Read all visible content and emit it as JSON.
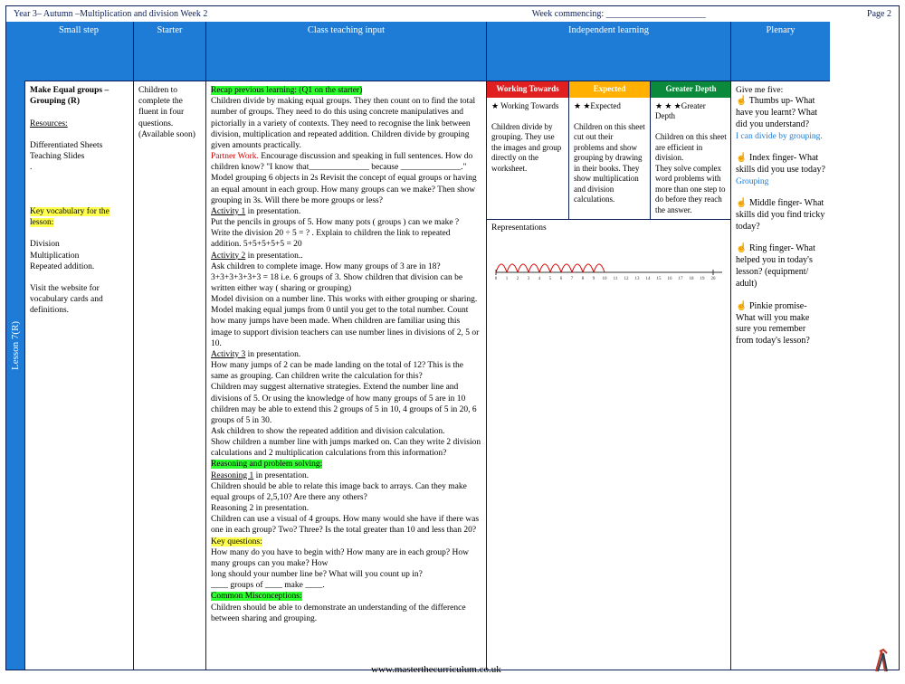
{
  "top": {
    "left": "Year 3– Autumn –Multiplication and division Week 2",
    "mid": "Week commencing: ______________________",
    "right": "Page 2"
  },
  "lesson_tab": "Lesson  7(R)",
  "headers": {
    "small_step": "Small step",
    "starter": "Starter",
    "teaching": "Class teaching input",
    "independent": "Independent learning",
    "plenary": "Plenary"
  },
  "small_step": {
    "title": "Make Equal groups – Grouping (R)",
    "resources_label": "Resources:",
    "resources": "Differentiated Sheets\nTeaching Slides\n.",
    "vocab_hl": "Key vocabulary for the lesson:",
    "vocab": "Division\nMultiplication\nRepeated addition.",
    "site": "Visit the website for vocabulary cards and definitions."
  },
  "starter": "Children to complete the fluent in four questions. (Available soon)",
  "teaching": {
    "recap": "Recap previous learning: (Q1 on the starter)",
    "p1": "Children divide by making equal groups. They then count on to find the total number of groups. They need to do this using concrete manipulatives and pictorially in a variety of contexts. They need to recognise the link between division, multiplication and repeated addition. Children divide by grouping given amounts practically.",
    "partner_label": "Partner Work.",
    "partner": "Encourage discussion and speaking in full sentences. How do children know?  \"I know that______________ because ______________.\"",
    "model": "Model grouping 6 objects in 2s  Revisit the concept of equal groups or having an equal amount in each group. How many groups can we make? Then show grouping in 3s. Will there be more groups or less?",
    "act1_h": "Activity 1",
    "act1_t": " in presentation.",
    "act1": "Put the pencils in groups of 5. How many pots ( groups )  can we make ?\nWrite the division  20 ÷ 5 = ? . Explain to children the link to repeated addition.   5+5+5+5+5 = 20",
    "act2_h": "Activity 2",
    "act2_t": " in presentation..",
    "act2": "Ask children to complete image. How many groups of 3 are in 18?\n3+3+3+3+3+3 = 18 i.e. 6 groups of 3. Show children that division can be written either way ( sharing or grouping)\nModel division on a number line. This works with either grouping or sharing. Model making equal jumps from 0 until you get to the total number. Count how many jumps have been made.  When children are familiar using this image to support division teachers can use number lines in divisions  of 2, 5 or 10.",
    "act3_h": "Activity 3",
    "act3_t": " in presentation.",
    "act3": "How many jumps of 2 can be made landing on the total of 12? This is the same as grouping. Can children write the calculation for this?\nChildren may suggest alternative strategies. Extend the number line and divisions of 5. Or using the knowledge of how many groups of 5 are in 10 children may be able to extend this 2 groups of 5 in 10, 4 groups of 5 in 20, 6 groups of 5 in 30.\nAsk children to show the repeated addition and division calculation.\nShow children a number line with  jumps marked on. Can they write 2 division calculations and 2 multiplication calculations from this information?",
    "reason_hl": "Reasoning and problem solving:",
    "r1_h": "Reasoning 1",
    "r1_t": " in presentation.",
    "r1": "Children should be able to relate this image back to arrays. Can they make equal groups of 2,5,10? Are there any others?",
    "r2": "Reasoning 2 in presentation.\nChildren can use a visual of 4 groups. How many would she have if there was one in each group? Two? Three? Is the total greater than 10 and less than 20?",
    "kq_hl": "Key questions:",
    "kq": "How many do you have to begin with? How many are in each group? How many groups can you make? How\nlong should your number line be? What will you count up in?\n____ groups of ____ make ____.",
    "cm_hl": "Common Misconceptions:",
    "cm": "Children should be able to demonstrate an understanding of the  difference between sharing and grouping."
  },
  "independent": {
    "wt_h": "Working Towards",
    "wt_stars": "★",
    "wt_label": " Working Towards",
    "wt": "Children divide by grouping. They use the images and group directly on the worksheet.",
    "ex_h": "Expected",
    "ex_stars": "★ ★",
    "ex_label": "Expected",
    "ex": "Children on this sheet cut out their problems and show grouping by drawing in their books. They show multiplication and division calculations.",
    "gd_h": "Greater Depth",
    "gd_stars": "★ ★ ★",
    "gd_label": "Greater Depth",
    "gd": "Children on this sheet are efficient in division.\nThey solve complex word problems with more than one step to do before they reach\nthe answer.",
    "reps": "Representations"
  },
  "plenary": {
    "title": "Give me five:",
    "thumb": "☝ Thumbs up- What have you learnt? What did you understand?",
    "thumb_ans": "I can divide by grouping.",
    "index": "☝ Index finger- What skills did you use today?",
    "index_ans": "Grouping",
    "middle": "☝ Middle finger- What skills did you find tricky today?",
    "ring": "☝ Ring finger- What helped you in today's lesson? (equipment/ adult)",
    "pinkie": "☝ Pinkie promise- What will you make sure you remember from today's lesson?"
  },
  "url": "www.masterthecurriculum.co.uk"
}
